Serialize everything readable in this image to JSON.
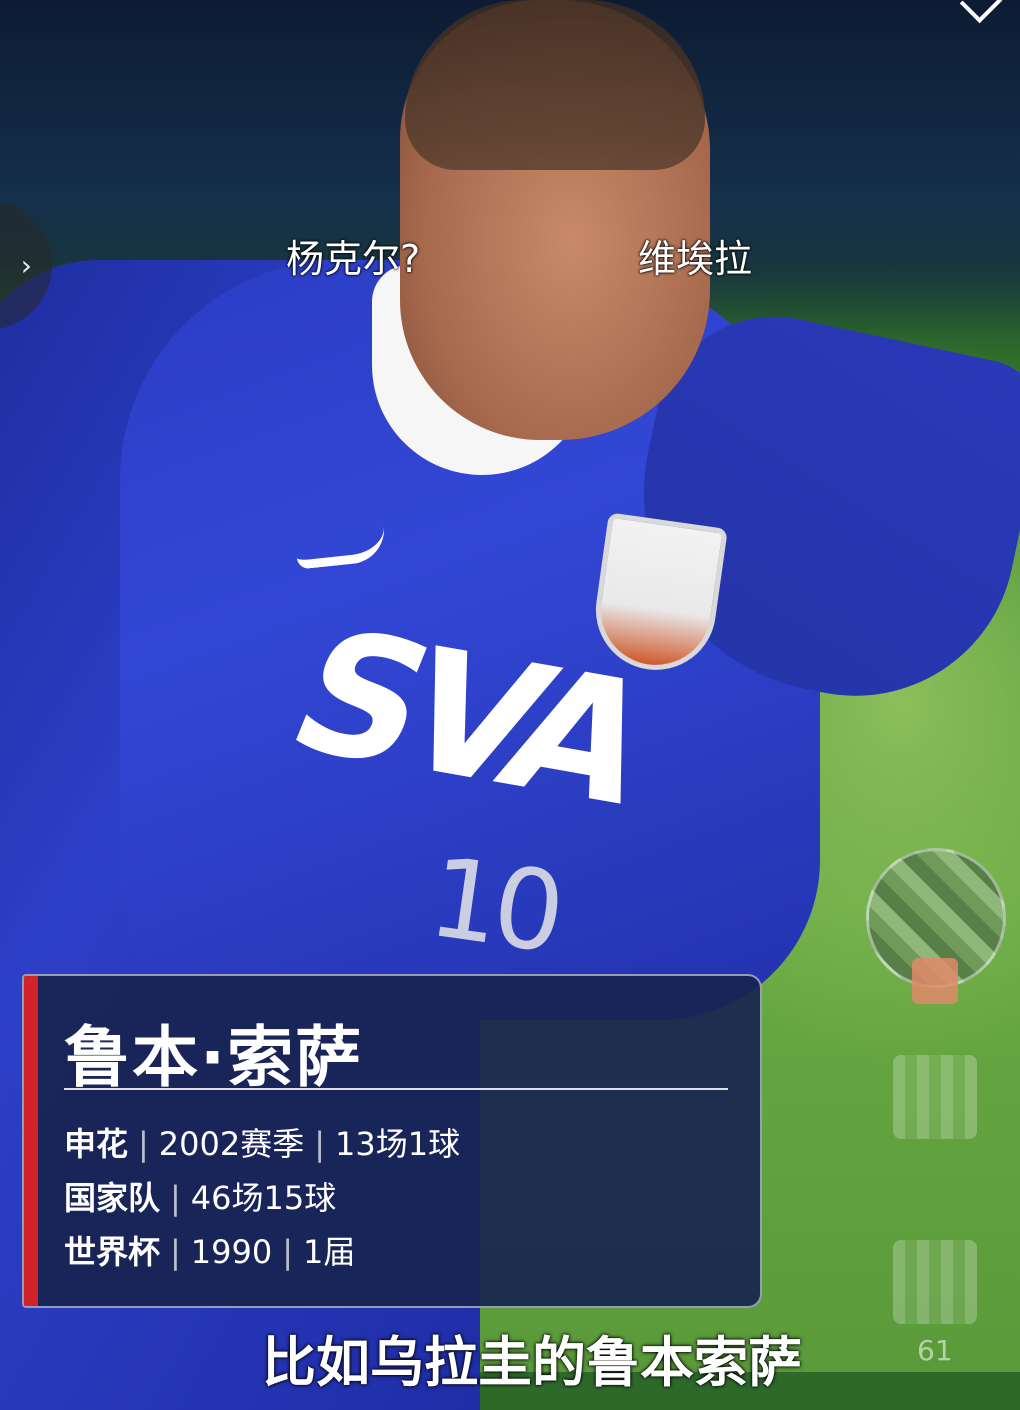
{
  "video": {
    "annotations": {
      "left_name": "杨克尔?",
      "right_name": "维埃拉"
    },
    "jersey": {
      "sponsor": "SVA",
      "number": "10"
    },
    "subtitle": "比如乌拉圭的鲁本索萨"
  },
  "info_card": {
    "name": "鲁本·索萨",
    "rows": [
      {
        "label": "申花",
        "values": [
          "2002赛季",
          "13场1球"
        ]
      },
      {
        "label": "国家队",
        "values": [
          "46场15球"
        ]
      },
      {
        "label": "世界杯",
        "values": [
          "1990",
          "1届"
        ]
      }
    ],
    "accent_color": "#d3232a"
  },
  "side_rail": {
    "back_icon": "chevron-right-icon",
    "comment_count": "61"
  }
}
